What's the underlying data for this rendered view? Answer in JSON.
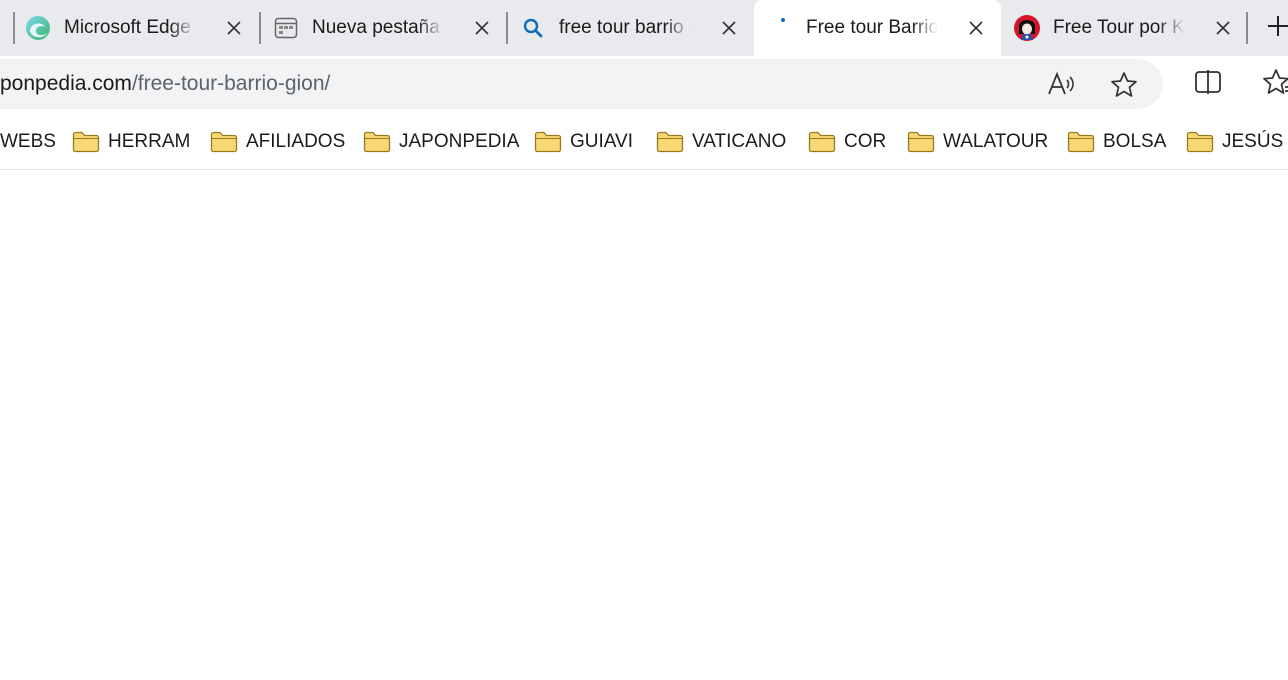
{
  "tabs": [
    {
      "title": "Microsoft Edge | Novedades",
      "icon": "edge-logo-icon"
    },
    {
      "title": "Nueva pestaña",
      "icon": "new-tab-page-icon"
    },
    {
      "title": "free tour barrio gion",
      "icon": "search-icon"
    },
    {
      "title": "Free tour Barrio de Gion",
      "icon": "loading-dot-icon",
      "active": true
    },
    {
      "title": "Free Tour por Kioto",
      "icon": "geisha-favicon-icon"
    }
  ],
  "address_bar": {
    "host": "ponpedia.com",
    "path": "/free-tour-barrio-gion/"
  },
  "toolbar_icons": [
    "read-aloud-icon",
    "add-favorite-star-icon",
    "split-screen-icon",
    "favorites-icon"
  ],
  "favorites": [
    {
      "label": "WEBS"
    },
    {
      "label": "HERRAM"
    },
    {
      "label": "AFILIADOS"
    },
    {
      "label": "JAPONPEDIA"
    },
    {
      "label": "GUIAVI"
    },
    {
      "label": "VATICANO"
    },
    {
      "label": "COR"
    },
    {
      "label": "WALATOUR"
    },
    {
      "label": "BOLSA"
    },
    {
      "label": "JESÚS"
    }
  ],
  "colors": {
    "tabstrip_bg": "#e9eaed",
    "accent": "#0f6cbd",
    "folder": "#f8d775"
  }
}
